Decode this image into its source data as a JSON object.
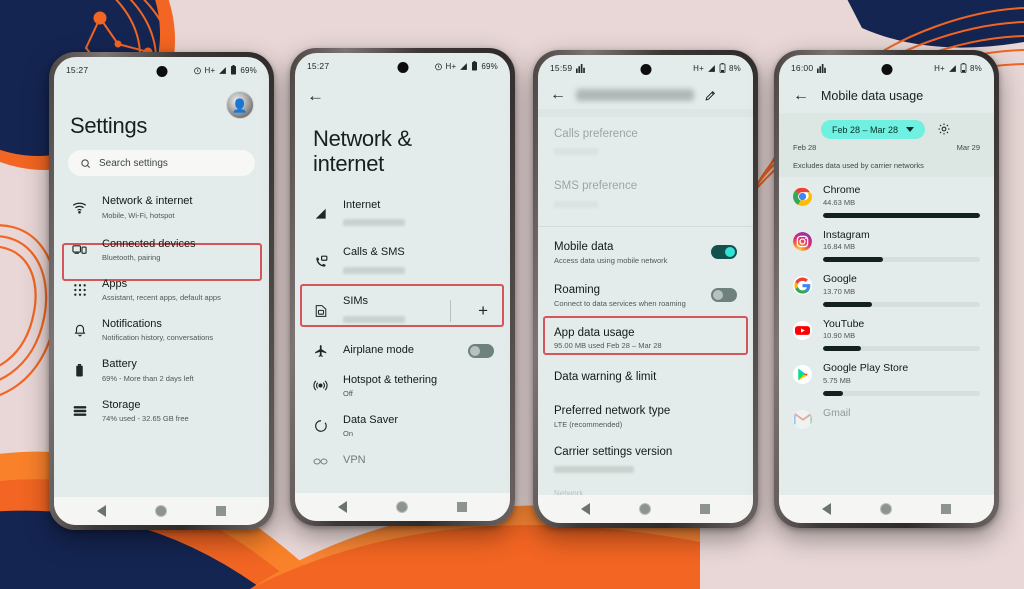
{
  "background": {
    "base_color": "#e8d7d6",
    "navy": "#152552",
    "orange": "#f26522",
    "orange_light": "#f9812a"
  },
  "highlight_color": "#d4565b",
  "phones": [
    {
      "id": "settings-home",
      "status": {
        "time": "15:27",
        "network": "H+",
        "battery": "69%",
        "alarm_icon": "alarm-icon",
        "signal_icon": "signal-icon",
        "battery_icon": "battery-icon"
      },
      "search": {
        "placeholder": "Search settings",
        "icon": "search-icon"
      },
      "title": "Settings",
      "avatar": "account-avatar",
      "items": [
        {
          "icon": "wifi-icon",
          "label": "Network & internet",
          "sub": "Mobile, Wi-Fi, hotspot",
          "highlighted": true
        },
        {
          "icon": "devices-icon",
          "label": "Connected devices",
          "sub": "Bluetooth, pairing",
          "highlighted": false
        },
        {
          "icon": "apps-grid-icon",
          "label": "Apps",
          "sub": "Assistant, recent apps, default apps",
          "highlighted": false
        },
        {
          "icon": "bell-icon",
          "label": "Notifications",
          "sub": "Notification history, conversations",
          "highlighted": false
        },
        {
          "icon": "battery-icon",
          "label": "Battery",
          "sub": "69% - More than 2 days left",
          "highlighted": false
        },
        {
          "icon": "storage-icon",
          "label": "Storage",
          "sub": "74% used - 32.65 GB free",
          "highlighted": false
        }
      ]
    },
    {
      "id": "network-internet",
      "status": {
        "time": "15:27",
        "network": "H+",
        "battery": "69%",
        "alarm_icon": "alarm-icon",
        "signal_icon": "signal-icon",
        "battery_icon": "battery-icon"
      },
      "back": "back-arrow-icon",
      "title": "Network & internet",
      "items": [
        {
          "icon": "signal-triangle-icon",
          "label": "Internet",
          "sub": "",
          "redacted": true,
          "highlighted": false
        },
        {
          "icon": "calls-sms-icon",
          "label": "Calls & SMS",
          "sub": "",
          "redacted": true,
          "highlighted": false
        },
        {
          "icon": "sim-card-icon",
          "label": "SIMs",
          "sub": "",
          "redacted": true,
          "highlighted": true,
          "trailing": "plus-icon"
        },
        {
          "icon": "airplane-icon",
          "label": "Airplane mode",
          "sub": "",
          "toggle": "off",
          "highlighted": false
        },
        {
          "icon": "hotspot-icon",
          "label": "Hotspot & tethering",
          "sub": "Off",
          "highlighted": false
        },
        {
          "icon": "data-saver-icon",
          "label": "Data Saver",
          "sub": "On",
          "highlighted": false
        },
        {
          "icon": "vpn-icon",
          "label": "VPN",
          "sub": "",
          "cutoff": true,
          "highlighted": false
        }
      ]
    },
    {
      "id": "sim-detail",
      "status": {
        "time": "15:59",
        "network": "H+",
        "battery": "8%",
        "chart_icon": "signal-bars-icon",
        "signal_icon": "signal-icon",
        "battery_icon": "battery-icon"
      },
      "back": "back-arrow-icon",
      "title_redacted": true,
      "edit": "pencil-icon",
      "items": [
        {
          "label": "Calls preference",
          "sub": "",
          "faded": true,
          "redacted": true
        },
        {
          "label": "SMS preference",
          "sub": "",
          "faded": true,
          "redacted": true
        },
        {
          "label": "Mobile data",
          "sub": "Access data using mobile network",
          "toggle": "on"
        },
        {
          "label": "Roaming",
          "sub": "Connect to data services when roaming",
          "toggle": "off"
        },
        {
          "label": "App data usage",
          "sub": "95.00 MB used Feb 28 – Mar 28",
          "highlighted": true
        },
        {
          "label": "Data warning & limit",
          "sub": ""
        },
        {
          "label": "Preferred network type",
          "sub": "LTE (recommended)"
        },
        {
          "label": "Carrier settings version",
          "sub": "",
          "redacted": true
        }
      ],
      "footer_cutoff": "Network"
    },
    {
      "id": "mobile-data-usage",
      "status": {
        "time": "16:00",
        "network": "H+",
        "battery": "8%",
        "chart_icon": "signal-bars-icon",
        "signal_icon": "signal-icon",
        "battery_icon": "battery-icon"
      },
      "back": "back-arrow-icon",
      "title": "Mobile data usage",
      "date_chip": "Feb 28 – Mar 28",
      "chip_caret": "chevron-down-icon",
      "settings_gear": "gear-icon",
      "range_start": "Feb 28",
      "range_end": "Mar 29",
      "note": "Excludes data used by carrier networks",
      "apps": [
        {
          "name": "Chrome",
          "size": "44.63 MB",
          "pct": 100,
          "icon": "chrome-icon"
        },
        {
          "name": "Instagram",
          "size": "16.84 MB",
          "pct": 38,
          "icon": "instagram-icon"
        },
        {
          "name": "Google",
          "size": "13.70 MB",
          "pct": 31,
          "icon": "google-icon"
        },
        {
          "name": "YouTube",
          "size": "10.90 MB",
          "pct": 24,
          "icon": "youtube-icon"
        },
        {
          "name": "Google Play Store",
          "size": "5.75 MB",
          "pct": 13,
          "icon": "play-store-icon"
        },
        {
          "name": "Gmail",
          "size": "",
          "pct": 0,
          "icon": "gmail-icon",
          "cutoff": true
        }
      ]
    }
  ]
}
